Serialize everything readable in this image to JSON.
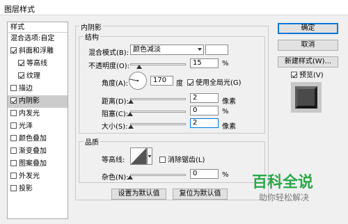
{
  "window": {
    "title": "图层样式"
  },
  "styles_panel": {
    "header": "样式",
    "items": [
      {
        "label": "混合选项:自定",
        "checkbox": false,
        "checked": false,
        "sub": false,
        "selected": false
      },
      {
        "label": "斜面和浮雕",
        "checkbox": true,
        "checked": true,
        "sub": false,
        "selected": false
      },
      {
        "label": "等高线",
        "checkbox": true,
        "checked": true,
        "sub": true,
        "selected": false
      },
      {
        "label": "纹理",
        "checkbox": true,
        "checked": true,
        "sub": true,
        "selected": false
      },
      {
        "label": "描边",
        "checkbox": true,
        "checked": false,
        "sub": false,
        "selected": false
      },
      {
        "label": "内阴影",
        "checkbox": true,
        "checked": true,
        "sub": false,
        "selected": true
      },
      {
        "label": "内发光",
        "checkbox": true,
        "checked": false,
        "sub": false,
        "selected": false
      },
      {
        "label": "光泽",
        "checkbox": true,
        "checked": false,
        "sub": false,
        "selected": false
      },
      {
        "label": "颜色叠加",
        "checkbox": true,
        "checked": false,
        "sub": false,
        "selected": false
      },
      {
        "label": "渐变叠加",
        "checkbox": true,
        "checked": false,
        "sub": false,
        "selected": false
      },
      {
        "label": "图案叠加",
        "checkbox": true,
        "checked": false,
        "sub": false,
        "selected": false
      },
      {
        "label": "外发光",
        "checkbox": true,
        "checked": false,
        "sub": false,
        "selected": false
      },
      {
        "label": "投影",
        "checkbox": true,
        "checked": false,
        "sub": false,
        "selected": false
      }
    ]
  },
  "inner_shadow": {
    "title": "内阴影",
    "structure": {
      "title": "结构",
      "blend_mode_label": "混合模式(B):",
      "blend_mode_value": "颜色减淡",
      "opacity_label": "不透明度(O):",
      "opacity_value": "15",
      "opacity_unit": "%",
      "opacity_level": 0.15,
      "angle_label": "角度(A):",
      "angle_value": "170",
      "angle_unit": "度",
      "global_light_label": "使用全局光(G)",
      "global_light_checked": true,
      "distance_label": "距离(D):",
      "distance_value": "2",
      "distance_unit": "像素",
      "choke_label": "阻塞(C):",
      "choke_value": "0",
      "choke_unit": "%",
      "size_label": "大小(S):",
      "size_value": "2",
      "size_unit": "像素"
    },
    "quality": {
      "title": "品质",
      "contour_label": "等高线:",
      "antialias_label": "消除锯齿(L)",
      "antialias_checked": false,
      "noise_label": "杂色(N):",
      "noise_value": "0",
      "noise_unit": "%"
    },
    "buttons": {
      "make_default": "设置为默认值",
      "reset_default": "复位为默认值"
    }
  },
  "actions": {
    "ok": "确定",
    "cancel": "取消",
    "new_style": "新建样式(W)...",
    "preview_label": "预览(V)",
    "preview_checked": true
  },
  "watermark": {
    "title": "百科全说",
    "subtitle": "助你轻松解决",
    "color": "#2aa84a"
  }
}
